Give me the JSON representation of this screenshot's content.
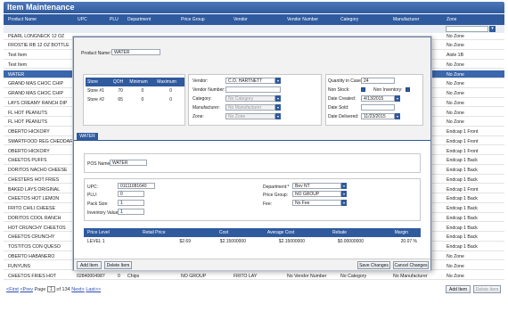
{
  "page": {
    "title": "Item Maintenance"
  },
  "grid": {
    "columns": [
      "Product Name",
      "UPC",
      "PLU",
      "Department",
      "Price Group",
      "Vendor",
      "Vendor Number",
      "Category",
      "Manufacturer",
      "Zone"
    ],
    "rows": [
      {
        "name": "PEARL LONGNECK 12 OZ",
        "zone": "No Zone"
      },
      {
        "name": "FROSTIE RB 12 OZ BOTTLE",
        "zone": "No Zone"
      },
      {
        "name": "Test Item",
        "zone": "Aisle 1B"
      },
      {
        "name": "Test Item",
        "zone": "No Zone"
      },
      {
        "name": "WATER",
        "zone": "No Zone",
        "selected": true
      },
      {
        "name": "GRAND MAS CHOC CHIP",
        "zone": "No Zone"
      },
      {
        "name": "GRAND MAS CHOC CHIP",
        "zone": "No Zone"
      },
      {
        "name": "LAYS CREAMY RANCH DIP",
        "zone": "No Zone"
      },
      {
        "name": "FL HOT PEANUTS",
        "zone": "No Zone"
      },
      {
        "name": "FL HOT PEANUTS",
        "zone": "No Zone"
      },
      {
        "name": "OBERTO HICKORY",
        "zone": "Endcap 1 Front"
      },
      {
        "name": "SMARTFOOD REG CHEDDAR",
        "zone": "Endcap 1 Front"
      },
      {
        "name": "OBERTO HICKORY",
        "zone": "Endcap 1 Front"
      },
      {
        "name": "CHEETOS PUFFS",
        "zone": "Endcap 1 Back"
      },
      {
        "name": "DORITOS NACHO CHEESE",
        "zone": "Endcap 1 Back"
      },
      {
        "name": "CHESTERS HOT FRIES",
        "zone": "Endcap 1 Back"
      },
      {
        "name": "BAKED LAYS ORIGINAL",
        "zone": "Endcap 1 Front"
      },
      {
        "name": "CHEETOS HOT LEMON",
        "zone": "Endcap 1 Back"
      },
      {
        "name": "FRITO CHILI CHEESE",
        "zone": "Endcap 1 Back"
      },
      {
        "name": "DORITOS COOL RANCH",
        "zone": "Endcap 1 Back"
      },
      {
        "name": "HOT CRUNCHY CHEETOS",
        "zone": "Endcap 1 Back"
      },
      {
        "name": "CHEETOS CRUNCHY",
        "zone": "Endcap 1 Back"
      },
      {
        "name": "TOSTITOS CON QUESO",
        "zone": "Endcap 1 Back"
      },
      {
        "name": "OBERTO HABANERO",
        "zone": "No Zone"
      },
      {
        "name": "FUNYUNS",
        "zone": "No Zone"
      }
    ],
    "last_row": {
      "name": "CHEETOS FRIES HOT",
      "upc": "02840004987",
      "plu": "0",
      "department": "Chips",
      "price_group": "NO GROUP",
      "vendor": "FRITO LAY",
      "vendor_number": "No Vendor Number",
      "category": "No Category",
      "manufacturer": "No Manufacturer",
      "zone": "No Zone"
    }
  },
  "pager": {
    "first": "<First",
    "prev": "<Prev",
    "page_label": "Page",
    "page_value": "1",
    "of_label": "of 134",
    "next": "Next>",
    "last": "Last>>"
  },
  "grid_buttons": {
    "add": "Add Item",
    "delete": "Delete Item"
  },
  "modal": {
    "product_name_label": "Product Name:*",
    "product_name_value": "WATER",
    "stores_table": {
      "headers": [
        "Store",
        "QOH",
        "Minimum",
        "Maximum"
      ],
      "rows": [
        [
          "Store #1",
          "70",
          "0",
          "0"
        ],
        [
          "Store #2",
          "65",
          "0",
          "0"
        ]
      ]
    },
    "vendor_label": "Vendor:",
    "vendor_value": "C.O. HARTNETT",
    "vendor_number_label": "Vendor Number:",
    "category_label": "Category:",
    "category_value": "No Category",
    "manufacturer_label": "Manufacturer:",
    "manufacturer_value": "No Manufacturer",
    "zone_label": "Zone:",
    "zone_value": "No Zone",
    "qty_case_label": "Quantity in Case:",
    "qty_case_value": "24",
    "non_stock_label": "Non Stock:",
    "non_inventory_label": "Non Inventory:",
    "date_created_label": "Date Created:",
    "date_created_value": "4/13/2015",
    "date_sold_label": "Date Sold:",
    "date_delivered_label": "Date Delivered:",
    "date_delivered_value": "11/23/2015",
    "tab_label": "WATER",
    "pos_name_label": "POS Name:*",
    "pos_name_value": "WATER",
    "upc_label": "UPC:",
    "upc_value": "01111081640",
    "plu_label": "PLU:",
    "plu_value": "0",
    "pack_size_label": "Pack Size:",
    "pack_size_value": "1",
    "inventory_value_label": "Inventory Value:",
    "inventory_value_value": "1",
    "department_label": "Department:*",
    "department_value": "Bev NT",
    "price_group_label": "Price Group:",
    "price_group_value": "NO GROUP",
    "fee_label": "Fee:",
    "fee_value": "No Fee",
    "price_table": {
      "headers": [
        "Price Level",
        "Retail Price",
        "Cost",
        "Average Cost",
        "Rebate",
        "Margin"
      ],
      "rows": [
        [
          "LEVEL 1",
          "$2.69",
          "$2.15000000",
          "$2.15000000",
          "$0.00000000",
          "20.07 %"
        ]
      ]
    },
    "buttons": {
      "add": "Add Item",
      "delete": "Delete Item",
      "save": "Save Changes",
      "cancel": "Cancel Changes"
    }
  },
  "colors": {
    "accent": "#2f5a9e",
    "selected_row": "#3a67ad"
  }
}
